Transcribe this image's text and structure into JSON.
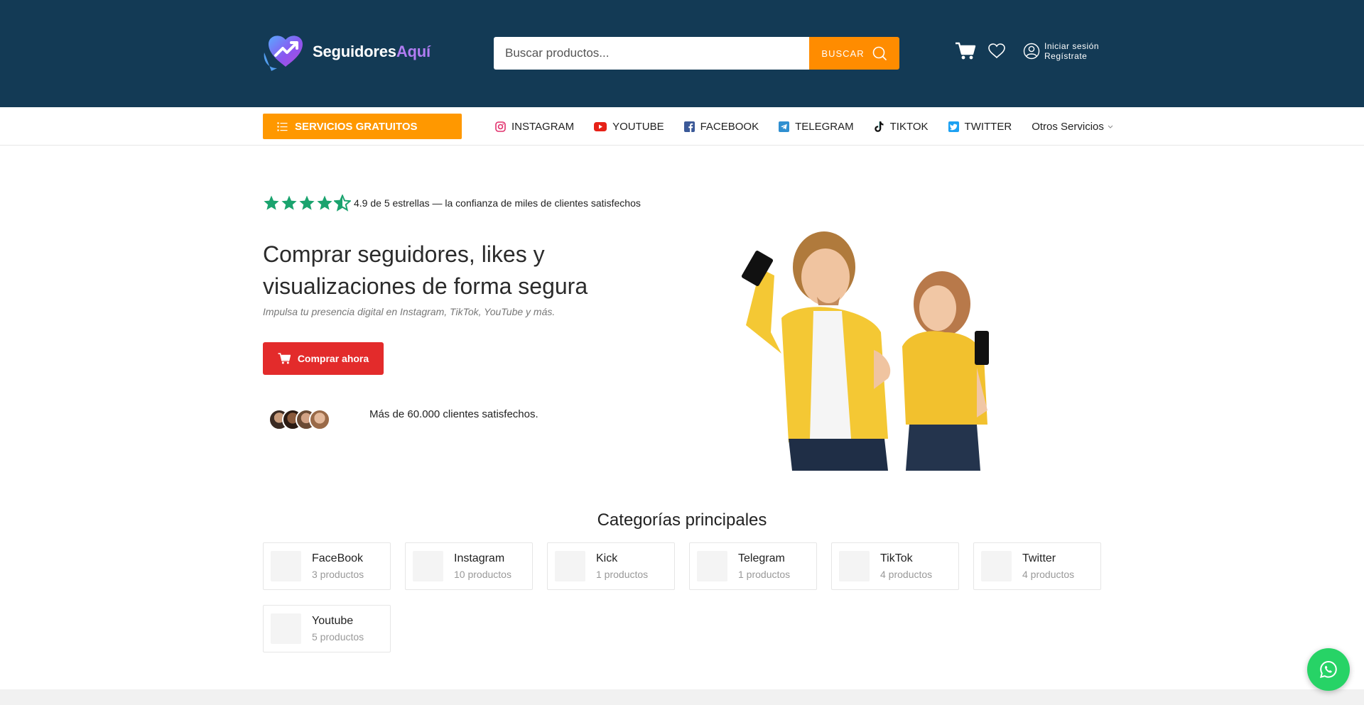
{
  "header": {
    "logo": {
      "name": "Seguidores",
      "accent": "Aquí"
    },
    "search": {
      "placeholder": "Buscar productos...",
      "value": "",
      "button_label": "BUSCAR"
    },
    "account": {
      "login": "Iniciar sesión",
      "register": "Regístrate"
    }
  },
  "nav": {
    "free_services_label": "SERVICIOS GRATUITOS",
    "items": [
      {
        "label": "INSTAGRAM",
        "icon": "instagram-icon"
      },
      {
        "label": "YOUTUBE",
        "icon": "youtube-icon"
      },
      {
        "label": "FACEBOOK",
        "icon": "facebook-icon"
      },
      {
        "label": "TELEGRAM",
        "icon": "telegram-icon"
      },
      {
        "label": "TIKTOK",
        "icon": "tiktok-icon"
      },
      {
        "label": "TWITTER",
        "icon": "twitter-icon"
      }
    ],
    "other_label": "Otros Servicios"
  },
  "hero": {
    "rating_value": 4.5,
    "rating_text": "4.9 de 5 estrellas — la confianza de miles de clientes satisfechos",
    "title": "Comprar seguidores, likes y visualizaciones de forma segura",
    "subtitle": "Impulsa tu presencia digital en Instagram, TikTok, YouTube y más.",
    "buy_label": "Comprar ahora",
    "clients_text": "Más de 60.000 clientes satisfechos."
  },
  "categories": {
    "title": "Categorías principales",
    "items": [
      {
        "name": "FaceBook",
        "count": "3 productos"
      },
      {
        "name": "Instagram",
        "count": "10 productos"
      },
      {
        "name": "Kick",
        "count": "1 productos"
      },
      {
        "name": "Telegram",
        "count": "1 productos"
      },
      {
        "name": "TikTok",
        "count": "4 productos"
      },
      {
        "name": "Twitter",
        "count": "4 productos"
      },
      {
        "name": "Youtube",
        "count": "5 productos"
      }
    ]
  },
  "colors": {
    "header_bg": "#133a55",
    "accent_orange": "#ff8c00",
    "buy_red": "#e32b2b",
    "star_green": "#1aa36e",
    "whatsapp_green": "#27d366"
  }
}
